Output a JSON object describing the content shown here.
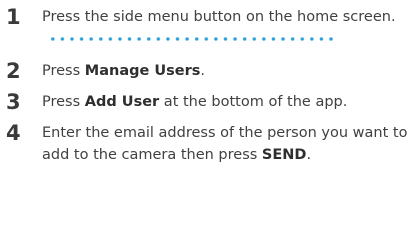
{
  "steps": [
    {
      "number": "1",
      "text_before": "Press the side menu button on the home screen.",
      "bold": "",
      "text_after": ""
    },
    {
      "number": "2",
      "text_before": "Press ",
      "bold": "Manage Users",
      "text_after": "."
    },
    {
      "number": "3",
      "text_before": "Press ",
      "bold": "Add User",
      "text_after": " at the bottom of the app."
    },
    {
      "number": "4",
      "text_before": "Enter the email address of the person you want to add to the camera then press ",
      "bold": "SEND",
      "text_after": "."
    }
  ],
  "colors": {
    "text": "#414042",
    "leader_dots": "#2e9fd8"
  }
}
